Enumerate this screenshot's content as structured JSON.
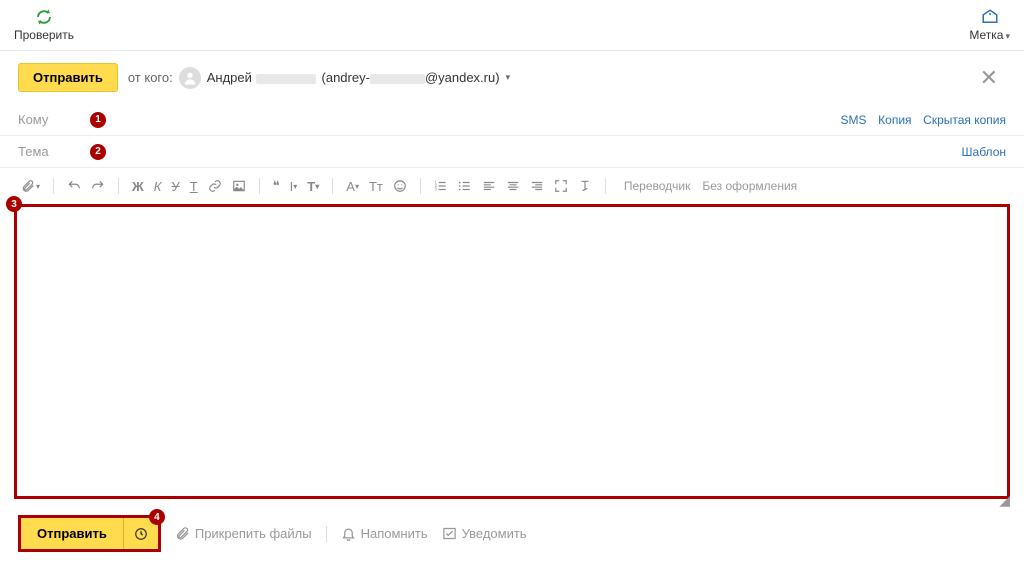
{
  "topbar": {
    "check_label": "Проверить",
    "tag_label": "Метка"
  },
  "compose": {
    "send_label": "Отправить",
    "from_label": "от кого:",
    "from_name": "Андрей",
    "from_email_prefix": "(andrey-",
    "from_email_suffix": "@yandex.ru)"
  },
  "fields": {
    "to_label": "Кому",
    "subject_label": "Тема",
    "sms": "SMS",
    "cc": "Копия",
    "bcc": "Скрытая копия",
    "template": "Шаблон"
  },
  "badges": {
    "b1": "1",
    "b2": "2",
    "b3": "3",
    "b4": "4"
  },
  "toolbar": {
    "bold": "Ж",
    "italic": "К",
    "strike": "У",
    "tformat": "Т",
    "quote": "❝",
    "iheight": "I",
    "tcase": "T",
    "acolor": "A",
    "tsize": "Tт",
    "translator": "Переводчик",
    "no_format": "Без оформления"
  },
  "footer": {
    "send_label": "Отправить",
    "attach": "Прикрепить файлы",
    "remind": "Напомнить",
    "notify": "Уведомить"
  }
}
